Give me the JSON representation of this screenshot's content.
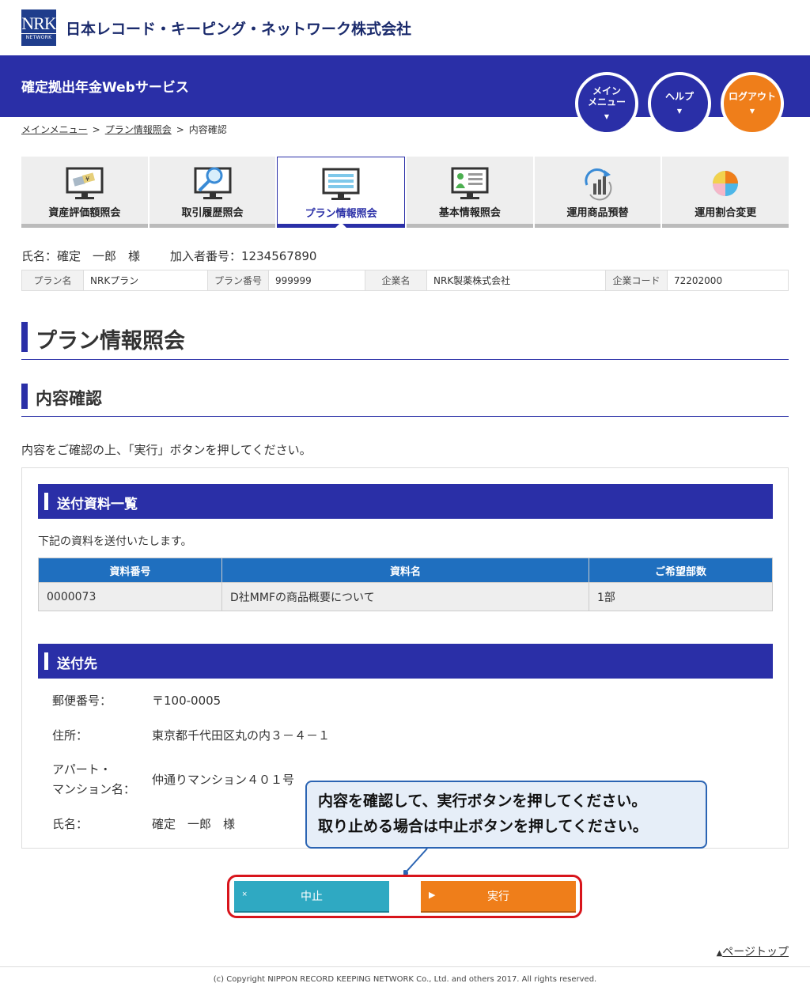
{
  "brand": {
    "logo_text": "NRK",
    "logo_sub": "NETWORK",
    "company": "日本レコード・キーピング・ネットワーク株式会社"
  },
  "header": {
    "service_title": "確定拠出年金Webサービス",
    "main_menu_line1": "メイン",
    "main_menu_line2": "メニュー",
    "help": "ヘルプ",
    "logout": "ログアウト"
  },
  "breadcrumb": {
    "item1": "メインメニュー",
    "item2": "プラン情報照会",
    "item3": "内容確認",
    "sep": ">"
  },
  "tabs": [
    {
      "label": "資産評価額照会",
      "icon": "asset-monitor-icon"
    },
    {
      "label": "取引履歴照会",
      "icon": "search-monitor-icon"
    },
    {
      "label": "プラン情報照会",
      "icon": "plan-monitor-icon",
      "active": true
    },
    {
      "label": "基本情報照会",
      "icon": "profile-monitor-icon"
    },
    {
      "label": "運用商品預替",
      "icon": "switch-chart-icon"
    },
    {
      "label": "運用割合変更",
      "icon": "pie-chart-icon"
    }
  ],
  "member": {
    "name": "氏名：確定　一郎　様",
    "number": "加入者番号：1234567890"
  },
  "plan_info": {
    "plan_name_label": "プラン名",
    "plan_name": "NRKプラン",
    "plan_no_label": "プラン番号",
    "plan_no": "999999",
    "company_label": "企業名",
    "company": "NRK製薬株式会社",
    "company_code_label": "企業コード",
    "company_code": "72202000"
  },
  "page_title": "プラン情報照会",
  "sub_title": "内容確認",
  "instruction": "内容をご確認の上、「実行」ボタンを押してください。",
  "documents": {
    "heading": "送付資料一覧",
    "note": "下記の資料を送付いたします。",
    "columns": [
      "資料番号",
      "資料名",
      "ご希望部数"
    ],
    "rows": [
      [
        "0000073",
        "D社MMFの商品概要について",
        "1部"
      ]
    ]
  },
  "destination": {
    "heading": "送付先",
    "postal_label": "郵便番号：",
    "postal": "〒100-0005",
    "address_label": "住所：",
    "address": "東京都千代田区丸の内３－４－１",
    "apt_label_1": "アパート・",
    "apt_label_2": "マンション名：",
    "apt": "仲通りマンション４０１号",
    "name_label": "氏名：",
    "name": "確定　一郎　様"
  },
  "balloon": {
    "line1": "内容を確認して、実行ボタンを押してください。",
    "line2": "取り止める場合は中止ボタンを押してください。"
  },
  "buttons": {
    "cancel": "中止",
    "cancel_mark": "×",
    "execute": "実行",
    "execute_mark": "▶"
  },
  "footer": {
    "pagetop": "ページトップ",
    "copyright": "(c) Copyright NIPPON RECORD KEEPING NETWORK Co., Ltd. and others 2017. All rights reserved."
  },
  "colors": {
    "brand_blue": "#2a2fa7",
    "logout_orange": "#ef7e1a",
    "cancel_teal": "#2fa9c2",
    "table_header": "#1f6fbf",
    "highlight_red": "#d8141b"
  }
}
